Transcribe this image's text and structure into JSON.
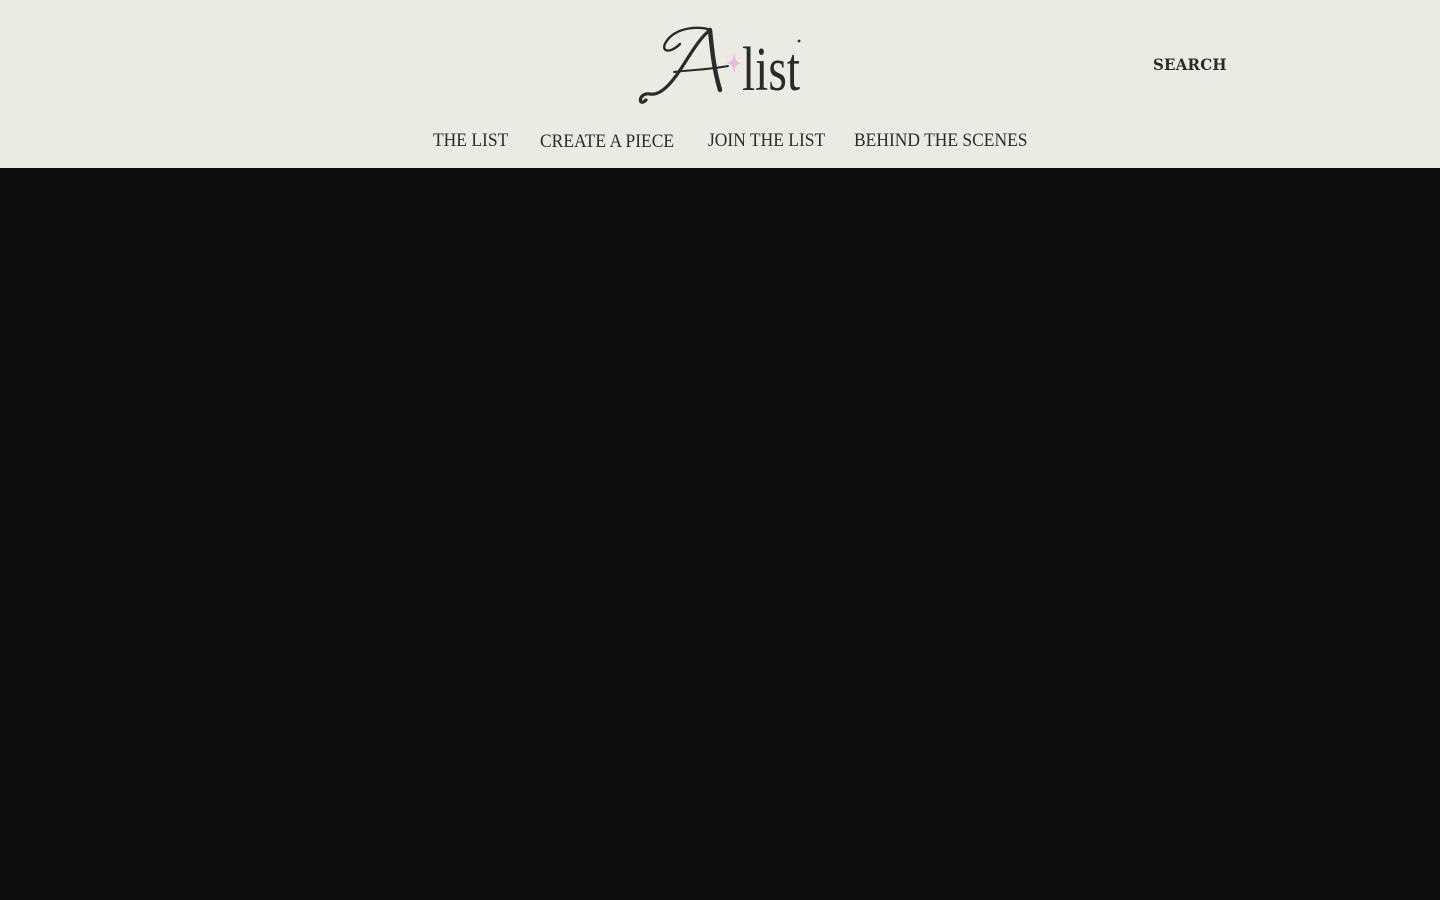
{
  "brand": {
    "logo_text": "A list",
    "sparkle_color": "#f0b4e2",
    "ink_color": "#2a2a2a"
  },
  "header": {
    "background": "#ebebe4",
    "search_label": "SEARCH"
  },
  "nav": {
    "items": [
      {
        "label": "THE LIST"
      },
      {
        "label": "CREATE A PIECE"
      },
      {
        "label": "JOIN THE LIST"
      },
      {
        "label": "BEHIND THE SCENES"
      }
    ]
  },
  "hero": {
    "background": "#0e0e0e"
  }
}
